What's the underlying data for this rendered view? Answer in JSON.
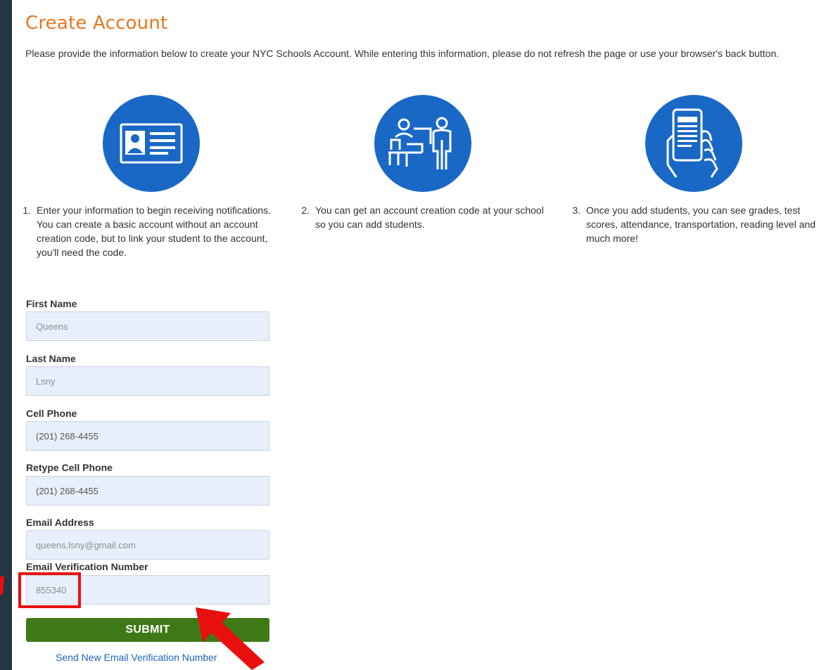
{
  "page": {
    "title": "Create Account",
    "intro": "Please provide the information below to create your NYC Schools Account. While entering this information, please do not refresh the page or use your browser's back button."
  },
  "steps": [
    {
      "number": "1.",
      "text": "Enter your information to begin receiving notifications. You can create a basic account without an account creation code, but to link your student to the account, you'll need the code.",
      "icon": "id-card-icon"
    },
    {
      "number": "2.",
      "text": "You can get an account creation code at your school so you can add students.",
      "icon": "school-desk-icon"
    },
    {
      "number": "3.",
      "text": "Once you add students, you can see grades, test scores, attendance, transportation, reading level and much more!",
      "icon": "phone-in-hand-icon"
    }
  ],
  "form": {
    "first_name": {
      "label": "First Name",
      "value": "Queens"
    },
    "last_name": {
      "label": "Last Name",
      "value": "Lsny"
    },
    "cell_phone": {
      "label": "Cell Phone",
      "value": "(201) 268-4455"
    },
    "retype_cell_phone": {
      "label": "Retype Cell Phone",
      "value": "(201) 268-4455"
    },
    "email": {
      "label": "Email Address",
      "value": "queens.lsny@gmail.com"
    },
    "verification": {
      "label": "Email Verification Number",
      "value": "855340"
    },
    "submit_label": "SUBMIT",
    "send_new_label": "Send New Email Verification Number"
  },
  "colors": {
    "title": "#e8761e",
    "icon_circle": "#1a68c5",
    "submit": "#3d7a16",
    "link": "#1d63b8",
    "annotation": "#e8100f",
    "input_bg": "#e8effa",
    "frame_bg": "#243641"
  }
}
